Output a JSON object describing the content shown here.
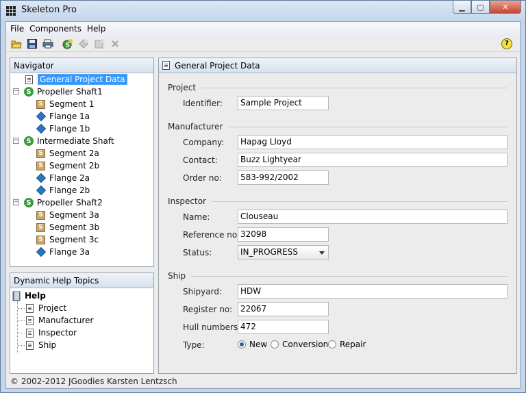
{
  "window": {
    "title": "Skeleton Pro",
    "minimize": "▁",
    "maximize": "▢",
    "close": "✕"
  },
  "menu": [
    "File",
    "Components",
    "Help"
  ],
  "toolbar": {
    "icons": [
      "open-folder-icon",
      "save-icon",
      "print-icon",
      "add-shaft-icon",
      "add-flange-icon",
      "add-segment-icon",
      "delete-icon",
      "help-icon"
    ],
    "help_glyph": "?"
  },
  "navigator": {
    "title": "Navigator",
    "items": [
      {
        "label": "General Project Data",
        "type": "doc",
        "level": 1,
        "selected": true
      },
      {
        "label": "Propeller Shaft1",
        "type": "shaft",
        "level": 0,
        "expander": "⊟"
      },
      {
        "label": "Segment 1",
        "type": "segment",
        "level": 2
      },
      {
        "label": "Flange 1a",
        "type": "flange",
        "level": 2
      },
      {
        "label": "Flange 1b",
        "type": "flange",
        "level": 2
      },
      {
        "label": "Intermediate Shaft",
        "type": "shaft",
        "level": 0,
        "expander": "⊟"
      },
      {
        "label": "Segment 2a",
        "type": "segment",
        "level": 2
      },
      {
        "label": "Segment 2b",
        "type": "segment",
        "level": 2
      },
      {
        "label": "Flange 2a",
        "type": "flange",
        "level": 2
      },
      {
        "label": "Flange 2b",
        "type": "flange",
        "level": 2
      },
      {
        "label": "Propeller Shaft2",
        "type": "shaft",
        "level": 0,
        "expander": "⊟"
      },
      {
        "label": "Segment 3a",
        "type": "segment",
        "level": 2
      },
      {
        "label": "Segment 3b",
        "type": "segment",
        "level": 2
      },
      {
        "label": "Segment 3c",
        "type": "segment",
        "level": 2
      },
      {
        "label": "Flange 3a",
        "type": "flange",
        "level": 2
      }
    ]
  },
  "help_topics": {
    "title": "Dynamic Help Topics",
    "root": "Help",
    "items": [
      "Project",
      "Manufacturer",
      "Inspector",
      "Ship"
    ]
  },
  "main": {
    "title": "General Project Data",
    "project": {
      "section": "Project",
      "identifier_label": "Identifier:",
      "identifier": "Sample Project"
    },
    "manufacturer": {
      "section": "Manufacturer",
      "company_label": "Company:",
      "company": "Hapag Lloyd",
      "contact_label": "Contact:",
      "contact": "Buzz Lightyear",
      "order_label": "Order no:",
      "order": "583-992/2002"
    },
    "inspector": {
      "section": "Inspector",
      "name_label": "Name:",
      "name": "Clouseau",
      "reference_label": "Reference no:",
      "reference": "32098",
      "status_label": "Status:",
      "status": "IN_PROGRESS"
    },
    "ship": {
      "section": "Ship",
      "shipyard_label": "Shipyard:",
      "shipyard": "HDW",
      "register_label": "Register no:",
      "register": "22067",
      "hull_label": "Hull numbers:",
      "hull": "472",
      "type_label": "Type:",
      "types": [
        "New",
        "Conversion",
        "Repair"
      ],
      "selected_type": "New"
    }
  },
  "status": "© 2002-2012 JGoodies Karsten Lentzsch"
}
